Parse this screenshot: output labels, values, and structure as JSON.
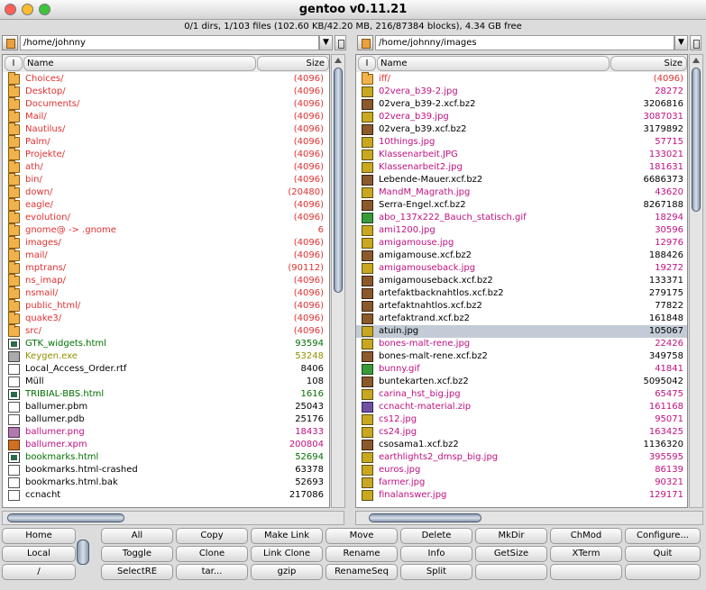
{
  "window": {
    "title": "gentoo v0.11.21"
  },
  "status": "0/1 dirs, 1/103 files (102.60 KB/42.20 MB, 216/87384 blocks), 4.34 GB free",
  "left_panel": {
    "path": "/home/johnny",
    "header": {
      "sel": "I",
      "name": "Name",
      "size": "Size"
    },
    "rows": [
      {
        "icon": "folder-icon",
        "type": "dir",
        "name": "Choices/",
        "size": "(4096)"
      },
      {
        "icon": "folder-icon",
        "type": "dir",
        "name": "Desktop/",
        "size": "(4096)"
      },
      {
        "icon": "folder-icon",
        "type": "dir",
        "name": "Documents/",
        "size": "(4096)"
      },
      {
        "icon": "folder-icon",
        "type": "dir",
        "name": "Mail/",
        "size": "(4096)"
      },
      {
        "icon": "folder-icon",
        "type": "dir",
        "name": "Nautilus/",
        "size": "(4096)"
      },
      {
        "icon": "folder-icon",
        "type": "dir",
        "name": "Palm/",
        "size": "(4096)"
      },
      {
        "icon": "folder-icon",
        "type": "dir",
        "name": "Projekte/",
        "size": "(4096)"
      },
      {
        "icon": "folder-icon",
        "type": "dir",
        "name": "ath/",
        "size": "(4096)"
      },
      {
        "icon": "folder-icon",
        "type": "dir",
        "name": "bin/",
        "size": "(4096)"
      },
      {
        "icon": "folder-icon",
        "type": "dir",
        "name": "down/",
        "size": "(20480)"
      },
      {
        "icon": "folder-icon",
        "type": "dir",
        "name": "eagle/",
        "size": "(4096)"
      },
      {
        "icon": "folder-icon",
        "type": "dir",
        "name": "evolution/",
        "size": "(4096)"
      },
      {
        "icon": "folder-icon",
        "type": "dir",
        "name": "gnome@ -> .gnome",
        "size": "6"
      },
      {
        "icon": "folder-icon",
        "type": "dir",
        "name": "images/",
        "size": "(4096)"
      },
      {
        "icon": "folder-icon",
        "type": "dir",
        "name": "mail/",
        "size": "(4096)"
      },
      {
        "icon": "folder-icon",
        "type": "dir",
        "name": "mptrans/",
        "size": "(90112)"
      },
      {
        "icon": "folder-icon",
        "type": "dir",
        "name": "ns_imap/",
        "size": "(4096)"
      },
      {
        "icon": "folder-icon",
        "type": "dir",
        "name": "nsmail/",
        "size": "(4096)"
      },
      {
        "icon": "folder-icon",
        "type": "dir",
        "name": "public_html/",
        "size": "(4096)"
      },
      {
        "icon": "folder-icon",
        "type": "dir",
        "name": "quake3/",
        "size": "(4096)"
      },
      {
        "icon": "folder-icon",
        "type": "dir",
        "name": "src/",
        "size": "(4096)"
      },
      {
        "icon": "html-icon",
        "type": "html",
        "name": "GTK_widgets.html",
        "size": "93594"
      },
      {
        "icon": "exe-icon",
        "type": "exe",
        "name": "Keygen.exe",
        "size": "53248"
      },
      {
        "icon": "document-icon",
        "type": "doc",
        "name": "Local_Access_Order.rtf",
        "size": "8406"
      },
      {
        "icon": "document-icon",
        "type": "doc",
        "name": "Müll",
        "size": "108"
      },
      {
        "icon": "html-icon",
        "type": "html",
        "name": "TRIBIAL-BBS.html",
        "size": "1616"
      },
      {
        "icon": "document-icon",
        "type": "doc",
        "name": "ballumer.pbm",
        "size": "25043"
      },
      {
        "icon": "document-icon",
        "type": "doc",
        "name": "ballumer.pdb",
        "size": "25176"
      },
      {
        "icon": "png-icon",
        "type": "img",
        "name": "ballumer.png",
        "size": "18433"
      },
      {
        "icon": "xpm-icon",
        "type": "img",
        "name": "ballumer.xpm",
        "size": "200804"
      },
      {
        "icon": "html-icon",
        "type": "html",
        "name": "bookmarks.html",
        "size": "52694"
      },
      {
        "icon": "document-icon",
        "type": "doc",
        "name": "bookmarks.html-crashed",
        "size": "63378"
      },
      {
        "icon": "document-icon",
        "type": "doc",
        "name": "bookmarks.html.bak",
        "size": "52693"
      },
      {
        "icon": "document-icon",
        "type": "doc",
        "name": "ccnacht",
        "size": "217086"
      }
    ]
  },
  "right_panel": {
    "path": "/home/johnny/images",
    "header": {
      "sel": "I",
      "name": "Name",
      "size": "Size"
    },
    "rows": [
      {
        "icon": "folder-icon",
        "type": "dir",
        "name": "iff/",
        "size": "(4096)"
      },
      {
        "icon": "jpeg-icon",
        "type": "img",
        "name": "02vera_b39-2.jpg",
        "size": "28272"
      },
      {
        "icon": "xcf-icon",
        "type": "xcf",
        "name": "02vera_b39-2.xcf.bz2",
        "size": "3206816"
      },
      {
        "icon": "jpeg-icon",
        "type": "img",
        "name": "02vera_b39.jpg",
        "size": "3087031"
      },
      {
        "icon": "xcf-icon",
        "type": "xcf",
        "name": "02vera_b39.xcf.bz2",
        "size": "3179892"
      },
      {
        "icon": "jpeg-icon",
        "type": "img",
        "name": "10things.jpg",
        "size": "57715"
      },
      {
        "icon": "jpeg-icon",
        "type": "img",
        "name": "Klassenarbeit.JPG",
        "size": "133021"
      },
      {
        "icon": "jpeg-icon",
        "type": "img",
        "name": "Klassenarbeit2.jpg",
        "size": "181631"
      },
      {
        "icon": "xcf-icon",
        "type": "xcf",
        "name": "Lebende-Mauer.xcf.bz2",
        "size": "6686373"
      },
      {
        "icon": "jpeg-icon",
        "type": "img",
        "name": "MandM_Magrath.jpg",
        "size": "43620"
      },
      {
        "icon": "xcf-icon",
        "type": "xcf",
        "name": "Serra-Engel.xcf.bz2",
        "size": "8267188"
      },
      {
        "icon": "gif-icon",
        "type": "gif",
        "name": "abo_137x222_Bauch_statisch.gif",
        "size": "18294"
      },
      {
        "icon": "jpeg-icon",
        "type": "img",
        "name": "ami1200.jpg",
        "size": "30596"
      },
      {
        "icon": "jpeg-icon",
        "type": "img",
        "name": "amigamouse.jpg",
        "size": "12976"
      },
      {
        "icon": "xcf-icon",
        "type": "xcf",
        "name": "amigamouse.xcf.bz2",
        "size": "188426"
      },
      {
        "icon": "jpeg-icon",
        "type": "img",
        "name": "amigamouseback.jpg",
        "size": "19272"
      },
      {
        "icon": "xcf-icon",
        "type": "xcf",
        "name": "amigamouseback.xcf.bz2",
        "size": "133371"
      },
      {
        "icon": "xcf-icon",
        "type": "xcf",
        "name": "artefaktbacknahtlos.xcf.bz2",
        "size": "279175"
      },
      {
        "icon": "xcf-icon",
        "type": "xcf",
        "name": "artefaktnahtlos.xcf.bz2",
        "size": "77822"
      },
      {
        "icon": "xcf-icon",
        "type": "xcf",
        "name": "artefaktrand.xcf.bz2",
        "size": "161848"
      },
      {
        "icon": "jpeg-icon",
        "type": "sel",
        "name": "atuin.jpg",
        "size": "105067",
        "selected": true
      },
      {
        "icon": "jpeg-icon",
        "type": "img",
        "name": "bones-malt-rene.jpg",
        "size": "22426"
      },
      {
        "icon": "xcf-icon",
        "type": "xcf",
        "name": "bones-malt-rene.xcf.bz2",
        "size": "349758"
      },
      {
        "icon": "gif-icon",
        "type": "gif",
        "name": "bunny.gif",
        "size": "41841"
      },
      {
        "icon": "xcf-icon",
        "type": "xcf",
        "name": "buntekarten.xcf.bz2",
        "size": "5095042"
      },
      {
        "icon": "jpeg-icon",
        "type": "img",
        "name": "carina_hst_big.jpg",
        "size": "65475"
      },
      {
        "icon": "zip-icon",
        "type": "zip",
        "name": "ccnacht-material.zip",
        "size": "161168"
      },
      {
        "icon": "jpeg-icon",
        "type": "img",
        "name": "cs12.jpg",
        "size": "95071"
      },
      {
        "icon": "jpeg-icon",
        "type": "img",
        "name": "cs24.jpg",
        "size": "163425"
      },
      {
        "icon": "xcf-icon",
        "type": "xcf",
        "name": "csosama1.xcf.bz2",
        "size": "1136320"
      },
      {
        "icon": "jpeg-icon",
        "type": "img",
        "name": "earthlights2_dmsp_big.jpg",
        "size": "395595"
      },
      {
        "icon": "jpeg-icon",
        "type": "img",
        "name": "euros.jpg",
        "size": "86139"
      },
      {
        "icon": "jpeg-icon",
        "type": "img",
        "name": "farmer.jpg",
        "size": "90321"
      },
      {
        "icon": "jpeg-icon",
        "type": "img",
        "name": "finalanswer.jpg",
        "size": "129171"
      }
    ]
  },
  "buttons": [
    {
      "label": "Home"
    },
    {
      "label": "Local"
    },
    {
      "label": "/"
    },
    {
      "label": "All"
    },
    {
      "label": "Toggle"
    },
    {
      "label": "SelectRE"
    },
    {
      "label": "Copy"
    },
    {
      "label": "Clone"
    },
    {
      "label": "tar..."
    },
    {
      "label": "Make Link"
    },
    {
      "label": "Link Clone"
    },
    {
      "label": "gzip"
    },
    {
      "label": "Move"
    },
    {
      "label": "Rename"
    },
    {
      "label": "RenameSeq"
    },
    {
      "label": "Delete"
    },
    {
      "label": "Info"
    },
    {
      "label": "Split"
    },
    {
      "label": "MkDir"
    },
    {
      "label": "GetSize"
    },
    {
      "label": ""
    },
    {
      "label": "ChMod"
    },
    {
      "label": "XTerm"
    },
    {
      "label": ""
    },
    {
      "label": "Configure..."
    },
    {
      "label": "Quit"
    },
    {
      "label": ""
    }
  ]
}
